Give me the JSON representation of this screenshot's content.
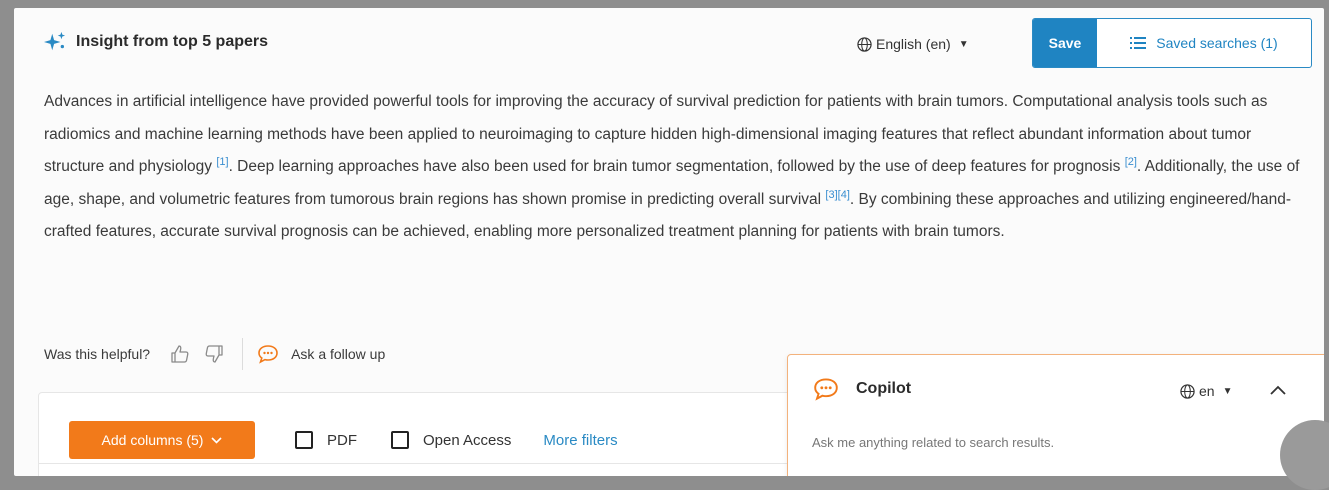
{
  "insight": {
    "title": "Insight from top 5 papers",
    "language": "English (en)",
    "save_label": "Save",
    "saved_searches_label": "Saved searches (1)",
    "paragraph": {
      "s1": "Advances in artificial intelligence have provided powerful tools for improving the accuracy of survival prediction for patients with brain tumors. Computational analysis tools such as radiomics and machine learning methods have been applied to neuroimaging to capture hidden high-dimensional imaging features that reflect abundant information about tumor structure and physiology ",
      "c1": "[1]",
      "s2": ". Deep learning approaches have also been used for brain tumor segmentation, followed by the use of deep features for prognosis ",
      "c2": "[2]",
      "s3": ". Additionally, the use of age, shape, and volumetric features from tumorous brain regions has shown promise in predicting overall survival ",
      "c3": "[3]",
      "c4": "[4]",
      "s4": ". By combining these approaches and utilizing engineered/hand-crafted features, accurate survival prognosis can be achieved, enabling more personalized treatment planning for patients with brain tumors."
    },
    "helpful_label": "Was this helpful?",
    "follow_up_label": "Ask a follow up"
  },
  "table_toolbar": {
    "add_columns_label": "Add columns (5)",
    "pdf_label": "PDF",
    "open_access_label": "Open Access",
    "more_filters_label": "More filters"
  },
  "copilot": {
    "title": "Copilot",
    "language": "en",
    "input_placeholder": "Ask me anything related to search results."
  },
  "colors": {
    "accent_blue": "#1f84c2",
    "accent_orange": "#f27a1a",
    "citation_blue": "#3a8ed0"
  },
  "icons": [
    "sparkle-icon",
    "globe-icon",
    "caret-down-icon",
    "list-icon",
    "thumbs-up-icon",
    "thumbs-down-icon",
    "chat-bubble-icon",
    "chevron-up-icon"
  ]
}
